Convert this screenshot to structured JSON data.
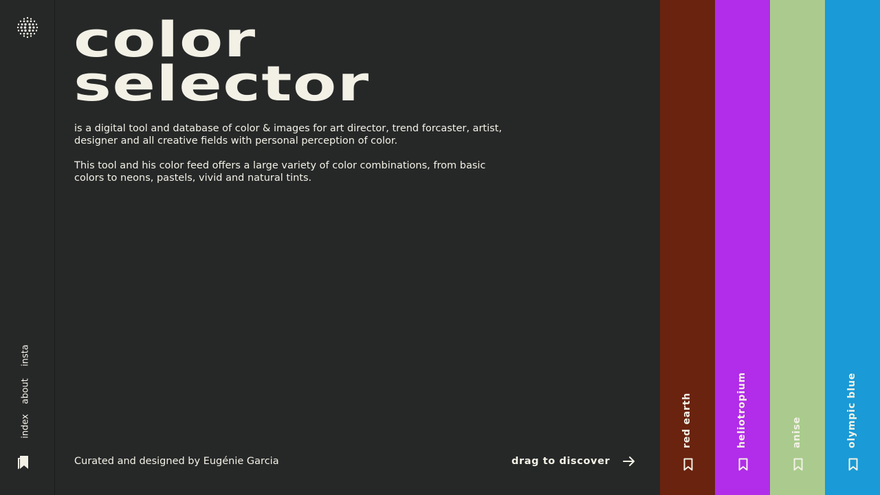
{
  "nav": {
    "items": [
      {
        "label": "insta"
      },
      {
        "label": "about"
      },
      {
        "label": "index"
      }
    ]
  },
  "hero": {
    "title_line1": "color",
    "title_line2": "selector",
    "paragraph1": "is a digital tool and database of color & images for art director, trend forcaster, artist, designer and all creative fields with personal perception of color.",
    "paragraph2": "This tool and his color feed offers a large variety of color combinations, from basic colors to neons, pastels, vivid and natural tints."
  },
  "footer": {
    "credit": "Curated and designed by Eugénie Garcia",
    "drag_label": "drag to discover"
  },
  "swatches": [
    {
      "name": "red earth",
      "color": "#6a230f"
    },
    {
      "name": "heliotropium",
      "color": "#b12de9"
    },
    {
      "name": "anise",
      "color": "#aacb8d"
    },
    {
      "name": "olympic blue",
      "color": "#1a9ad6"
    }
  ],
  "colors": {
    "background": "#262828",
    "text": "#f3f1e6"
  }
}
